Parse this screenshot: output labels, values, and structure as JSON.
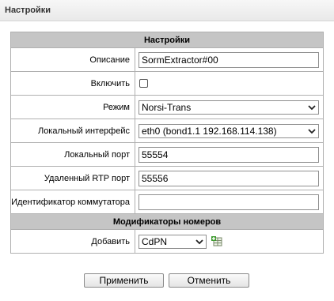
{
  "page": {
    "title": "Настройки"
  },
  "settings": {
    "header": "Настройки",
    "description": {
      "label": "Описание",
      "value": "SormExtractor#00"
    },
    "enable": {
      "label": "Включить",
      "checked": false
    },
    "mode": {
      "label": "Режим",
      "selected": "Norsi-Trans"
    },
    "local_interface": {
      "label": "Локальный интерфейс",
      "selected": "eth0 (bond1.1 192.168.114.138)"
    },
    "local_port": {
      "label": "Локальный порт",
      "value": "55554"
    },
    "remote_rtp_port": {
      "label": "Удаленный RTP порт",
      "value": "55556"
    },
    "switch_id": {
      "label": "Идентификатор коммутатора",
      "value": ""
    }
  },
  "number_modifiers": {
    "header": "Модификаторы номеров",
    "add": {
      "label": "Добавить",
      "selected": "CdPN",
      "icon": "add-row-icon"
    }
  },
  "buttons": {
    "apply": "Применить",
    "cancel": "Отменить"
  }
}
